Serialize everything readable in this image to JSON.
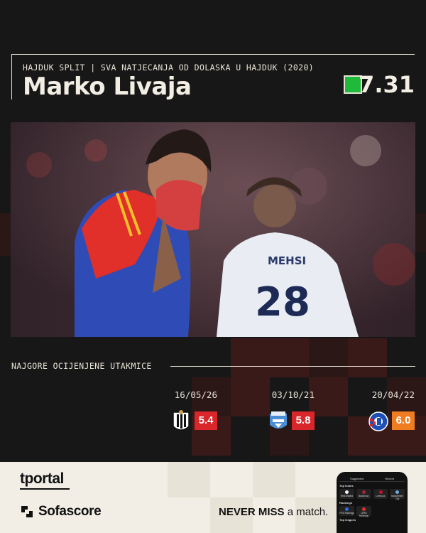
{
  "header": {
    "subtitle": "HAJDUK SPLIT | SVA NATJECANJA OD DOLASKA U HAJDUK (2020)",
    "player_name": "Marko Livaja",
    "rating": "7.31",
    "rating_color": "#1fba3a"
  },
  "photo": {
    "jersey_name": "MEHSI",
    "jersey_number": "28"
  },
  "matches_section": {
    "title": "NAJGORE OCIJENJENE UTAKMICE",
    "matches": [
      {
        "date": "16/05/26",
        "rating": "5.4",
        "rating_color": "#d9262a",
        "crest": "juventus-style-crest-icon"
      },
      {
        "date": "03/10/21",
        "rating": "5.8",
        "rating_color": "#d9262a",
        "crest": "osijek-crest-icon"
      },
      {
        "date": "20/04/22",
        "rating": "6.0",
        "rating_color": "#ee7d22",
        "crest": "dinamo-zagreb-crest-icon"
      }
    ]
  },
  "footer": {
    "brand1": "tportal",
    "brand2": "Sofascore",
    "slogan_bold": "NEVER MISS",
    "slogan_rest": " a match.",
    "phone": {
      "tab1": "Suggested",
      "tab2": "Recent",
      "section1": "Top teams",
      "teams": [
        "Real Madrid",
        "Barcelona",
        "Liverpool",
        "Manchester City"
      ],
      "section2": "Rankings",
      "rankings": [
        "FIFA Rankings",
        "UEFA Rankings"
      ],
      "section3": "Top leagues"
    }
  }
}
